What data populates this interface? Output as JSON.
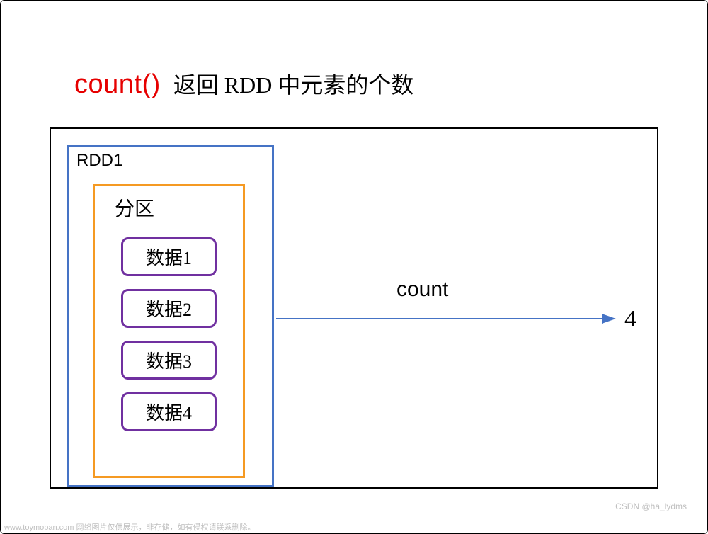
{
  "title": {
    "method": "count()",
    "description": "返回 RDD 中元素的个数"
  },
  "diagram": {
    "rdd_label": "RDD1",
    "partition_label": "分区",
    "data_items": [
      "数据1",
      "数据2",
      "数据3",
      "数据4"
    ],
    "arrow_label": "count",
    "result": "4"
  },
  "watermarks": {
    "left": "www.toymoban.com 网络图片仅供展示，非存储，如有侵权请联系删除。",
    "right": "CSDN @ha_lydms"
  },
  "colors": {
    "method_red": "#e60000",
    "rdd_border": "#4573c5",
    "partition_border": "#f59a23",
    "data_border": "#7030a0",
    "arrow": "#4573c5"
  }
}
